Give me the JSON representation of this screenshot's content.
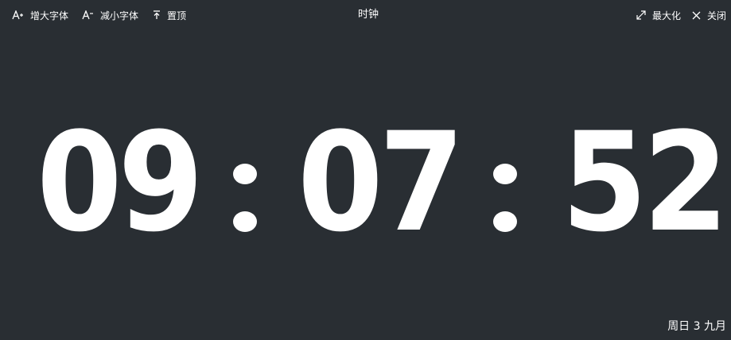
{
  "toolbar": {
    "increase_font": {
      "label": "增大字体",
      "icon": "font-increase-icon"
    },
    "decrease_font": {
      "label": "减小字体",
      "icon": "font-decrease-icon"
    },
    "pin_top": {
      "label": "置顶",
      "icon": "pin-top-icon"
    },
    "maximize": {
      "label": "最大化",
      "icon": "maximize-icon"
    },
    "close": {
      "label": "关闭",
      "icon": "close-icon"
    }
  },
  "window": {
    "title": "时钟"
  },
  "clock": {
    "hours": "09",
    "minutes": "07",
    "seconds": "52"
  },
  "date": {
    "text": "周日 3 九月"
  },
  "colors": {
    "background": "#292e33",
    "text": "#ffffff"
  }
}
